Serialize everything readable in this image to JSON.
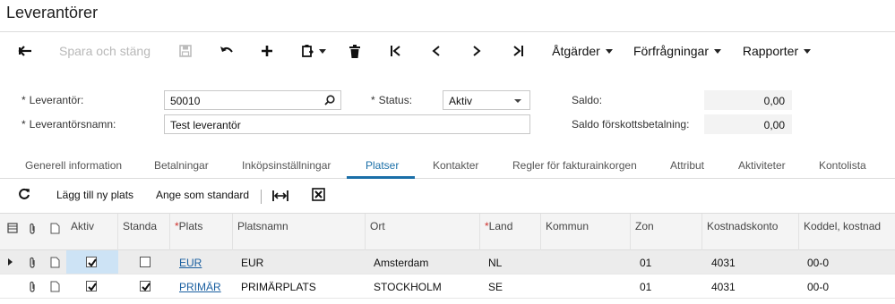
{
  "page": {
    "title": "Leverantörer"
  },
  "toolbar": {
    "back_icon": "arrow-left-icon",
    "save_close_label": "Spara och stäng",
    "save_icon": "floppy-disk-icon",
    "undo_icon": "undo-icon",
    "add_icon": "plus-icon",
    "copy_icon": "clipboard-icon",
    "delete_icon": "trash-icon",
    "first_icon": "first-record-icon",
    "prev_icon": "previous-record-icon",
    "next_icon": "next-record-icon",
    "last_icon": "last-record-icon",
    "actions_label": "Åtgärder",
    "inquiries_label": "Förfrågningar",
    "reports_label": "Rapporter"
  },
  "form": {
    "supplier_label": "Leverantör:",
    "supplier_value": "50010",
    "supplier_name_label": "Leverantörsnamn:",
    "supplier_name_value": "Test leverantör",
    "status_label": "Status:",
    "status_value": "Aktiv",
    "balance_label": "Saldo:",
    "balance_value": "0,00",
    "prepayment_balance_label": "Saldo förskottsbetalning:",
    "prepayment_balance_value": "0,00",
    "required_mark": "*"
  },
  "tabs": [
    {
      "label": "Generell information"
    },
    {
      "label": "Betalningar"
    },
    {
      "label": "Inköpsinställningar"
    },
    {
      "label": "Platser"
    },
    {
      "label": "Kontakter"
    },
    {
      "label": "Regler för fakturainkorgen"
    },
    {
      "label": "Attribut"
    },
    {
      "label": "Aktiviteter"
    },
    {
      "label": "Kontolista"
    }
  ],
  "active_tab": "Platser",
  "grid_toolbar": {
    "refresh_icon": "refresh-icon",
    "add_location_label": "Lägg till ny plats",
    "set_default_label": "Ange som standard",
    "fit_columns_icon": "fit-columns-icon",
    "excel_icon": "export-excel-icon"
  },
  "grid": {
    "columns": {
      "active": "Aktiv",
      "default": "Standa",
      "location": "Plats",
      "location_name": "Platsnamn",
      "city": "Ort",
      "country": "Land",
      "municipality": "Kommun",
      "zone": "Zon",
      "cost_account": "Kostnadskonto",
      "cost_subaccount": "Koddel, kostnad",
      "required_mark": "*"
    },
    "rows": [
      {
        "active": true,
        "default": false,
        "location": "EUR",
        "location_name": "EUR",
        "city": "Amsterdam",
        "country": "NL",
        "municipality": "",
        "zone": "01",
        "cost_account": "4031",
        "cost_subaccount": "00-0"
      },
      {
        "active": true,
        "default": true,
        "location": "PRIMÄR",
        "location_name": "PRIMÄRPLATS",
        "city": "STOCKHOLM",
        "country": "SE",
        "municipality": "",
        "zone": "01",
        "cost_account": "4031",
        "cost_subaccount": "00-0"
      }
    ]
  },
  "colors": {
    "accent": "#1a6fa8",
    "link": "#1a5fa0",
    "required": "#d0312d",
    "selected_cell": "#cde3f5"
  }
}
